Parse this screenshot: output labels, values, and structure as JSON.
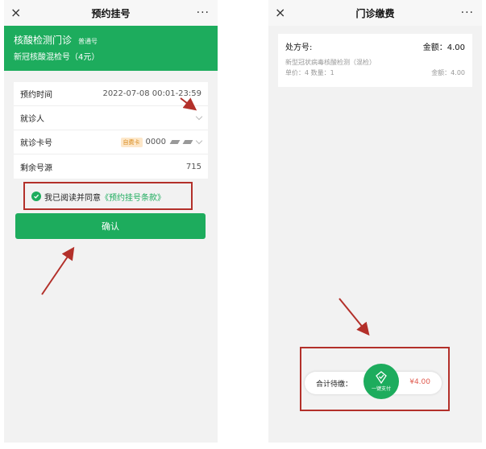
{
  "left": {
    "topbar": {
      "title": "预约挂号",
      "close_glyph": "×",
      "more_glyph": "···"
    },
    "clinic": {
      "name": "核酸检测门诊",
      "badge": "普通号",
      "service": "新冠核酸混检号（4元）"
    },
    "form": {
      "time_label": "预约时间",
      "time_value": "2022-07-08 00:01-23:59",
      "patient_label": "就诊人",
      "card_label": "就诊卡号",
      "card_type": "自费卡",
      "card_number": "0000",
      "remaining_label": "剩余号源",
      "remaining_value": "715"
    },
    "agree": {
      "text": "我已阅读并同意",
      "link": "《预约挂号条款》"
    },
    "confirm_label": "确认"
  },
  "right": {
    "topbar": {
      "title": "门诊缴费",
      "close_glyph": "×",
      "more_glyph": "···"
    },
    "prescription": {
      "label": "处方号:",
      "amount": "金额：4.00",
      "item": "新型冠状病毒核酸检测（混检）",
      "unit": "单价：4  数量：1",
      "item_amount": "金额：4.00"
    },
    "pay": {
      "total_label": "合计待缴：",
      "button_label": "一键支付",
      "price": "¥4.00"
    }
  },
  "colors": {
    "brand_green": "#1dac5d",
    "annotation_red": "#b3302a",
    "price_red": "#e05a4e"
  }
}
